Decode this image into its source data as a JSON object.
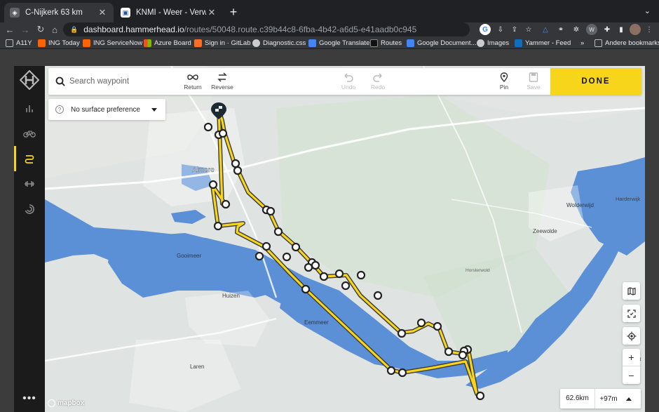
{
  "browser": {
    "tabs": [
      {
        "title": "C-Nijkerk 63 km",
        "active": true
      },
      {
        "title": "KNMI - Weer - Verwachtingen",
        "active": false
      }
    ],
    "url_host": "dashboard.hammerhead.io",
    "url_path": "/routes/50048.route.c39b44c8-6fba-4b42-a6d5-e41aadb0c945",
    "bookmarks": [
      "A11Y",
      "ING Today",
      "ING ServiceNow",
      "Azure Board",
      "Sign in · GitLab",
      "Diagnostic.css",
      "Google Translate",
      "Routes",
      "Google Document...",
      "Images",
      "Yammer - Feed"
    ],
    "bookmarks_more": "»",
    "other_bookmarks": "Andere bookmarks"
  },
  "toolbar": {
    "search_placeholder": "Search waypoint",
    "return_label": "Return",
    "reverse_label": "Reverse",
    "undo_label": "Undo",
    "redo_label": "Redo",
    "pin_label": "Pin",
    "save_label": "Save",
    "done_label": "DONE"
  },
  "surface": {
    "label": "No surface preference"
  },
  "map_labels": {
    "almere": "Almere",
    "gooimeer": "Gooimeer",
    "huizen": "Huizen",
    "eemmeer": "Eemmeer",
    "laren": "Laren",
    "wolderwijd": "Wolderwijd",
    "zeewolde": "Zeewolde",
    "horsterwold": "Horsterwold",
    "harderwijk": "Harderwijk",
    "putten": "Putt"
  },
  "stats": {
    "distance": "62.6km",
    "elevation": "+97m"
  },
  "attribution": "mapbox",
  "colors": {
    "accent": "#f7d51b",
    "water": "#5b8fd6",
    "land": "#dfe3e1",
    "route": "#f7d51b"
  }
}
